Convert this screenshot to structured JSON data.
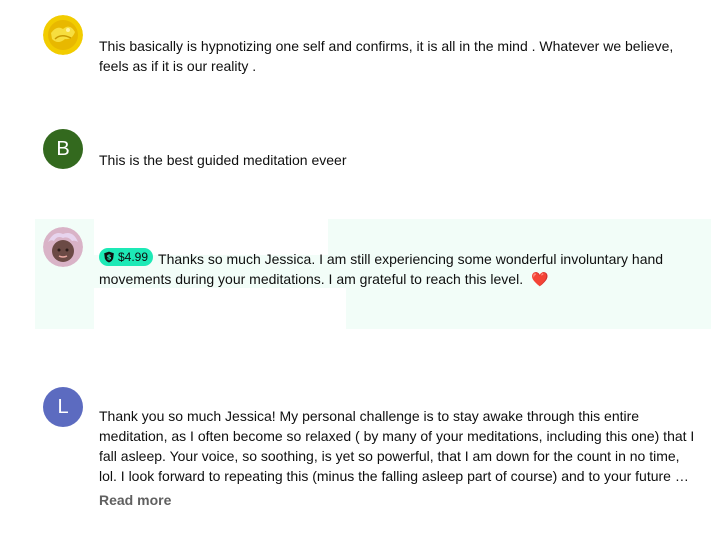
{
  "comments": [
    {
      "avatar_type": "image",
      "avatar_color": "#f2cc00",
      "text": "This basically is hypnotizing one self and confirms, it is all in  the mind . Whatever we believe, feels as if  it is our reality ."
    },
    {
      "avatar_type": "letter",
      "avatar_letter": "B",
      "avatar_color": "#33691e",
      "text": "This is the best guided meditation eveer"
    },
    {
      "avatar_type": "image",
      "avatar_color": "#d9b3c7",
      "highlighted": true,
      "highlight_color": "#f2fdf8",
      "super_thanks": {
        "amount": "$4.99",
        "badge_color": "#1de9b6",
        "icon": "super-thanks-dollar-icon"
      },
      "text": "Thanks so much Jessica. I am still experiencing some wonderful involuntary hand movements during your meditations. I am grateful to reach this level.",
      "emoji": "❤️"
    },
    {
      "avatar_type": "letter",
      "avatar_letter": "L",
      "avatar_color": "#5c6bc0",
      "text": "Thank you so much Jessica! My personal challenge is to stay awake through this entire meditation, as I often become so relaxed ( by many of your meditations, including this one) that I fall asleep. Your voice, so soothing, is yet so powerful, that I am down for the count in no time, lol. I look forward to repeating this (minus the falling asleep part of course) and to your future …",
      "read_more_label": "Read more"
    }
  ]
}
